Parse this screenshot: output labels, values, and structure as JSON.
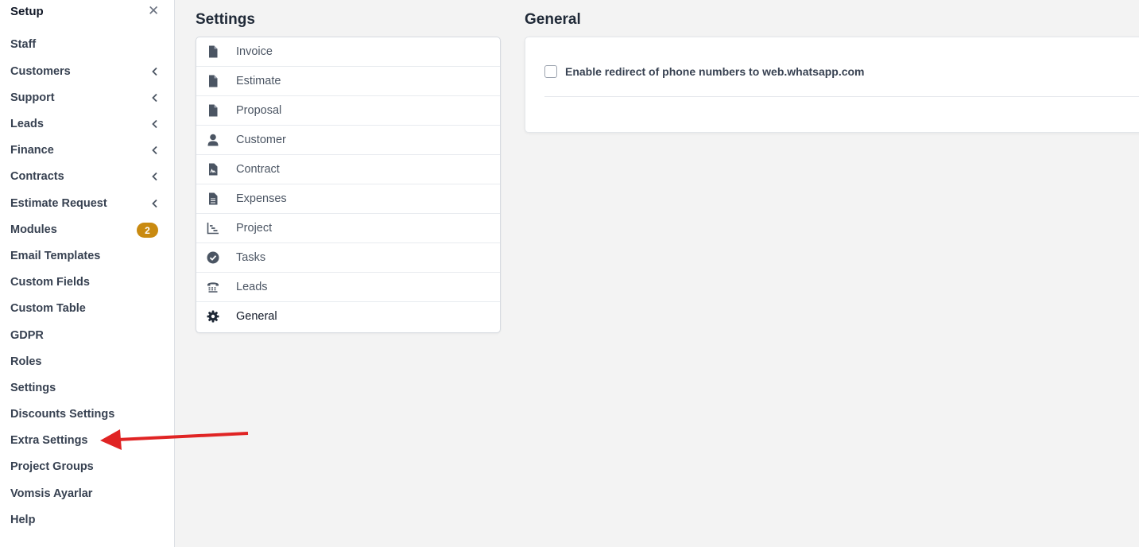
{
  "sidebar": {
    "title": "Setup",
    "close_glyph": "✕",
    "items": [
      {
        "label": "Staff"
      },
      {
        "label": "Customers",
        "icon": "chevron-left-icon"
      },
      {
        "label": "Support",
        "icon": "chevron-left-icon"
      },
      {
        "label": "Leads",
        "icon": "chevron-left-icon"
      },
      {
        "label": "Finance",
        "icon": "chevron-left-icon"
      },
      {
        "label": "Contracts",
        "icon": "chevron-left-icon"
      },
      {
        "label": "Estimate Request",
        "icon": "chevron-left-icon"
      },
      {
        "label": "Modules",
        "badge": "2"
      },
      {
        "label": "Email Templates"
      },
      {
        "label": "Custom Fields"
      },
      {
        "label": "Custom Table"
      },
      {
        "label": "GDPR"
      },
      {
        "label": "Roles"
      },
      {
        "label": "Settings"
      },
      {
        "label": "Discounts Settings"
      },
      {
        "label": "Extra Settings"
      },
      {
        "label": "Project Groups"
      },
      {
        "label": "Vomsis Ayarlar"
      },
      {
        "label": "Help"
      }
    ]
  },
  "settings_panel": {
    "title": "Settings",
    "items": [
      {
        "label": "Invoice",
        "icon": "file-icon"
      },
      {
        "label": "Estimate",
        "icon": "file-icon"
      },
      {
        "label": "Proposal",
        "icon": "file-icon"
      },
      {
        "label": "Customer",
        "icon": "user-icon"
      },
      {
        "label": "Contract",
        "icon": "file-signature-icon"
      },
      {
        "label": "Expenses",
        "icon": "file-lines-icon"
      },
      {
        "label": "Project",
        "icon": "chart-gantt-icon"
      },
      {
        "label": "Tasks",
        "icon": "circle-check-icon"
      },
      {
        "label": "Leads",
        "icon": "tty-icon"
      },
      {
        "label": "General",
        "icon": "gear-icon",
        "active": true
      }
    ]
  },
  "general_panel": {
    "title": "General",
    "checkbox_label": "Enable redirect of phone numbers to web.whatsapp.com",
    "checked": false
  },
  "colors": {
    "badge": "#c98a10",
    "annotation_arrow": "#e02424",
    "icon": "#4b5563"
  }
}
